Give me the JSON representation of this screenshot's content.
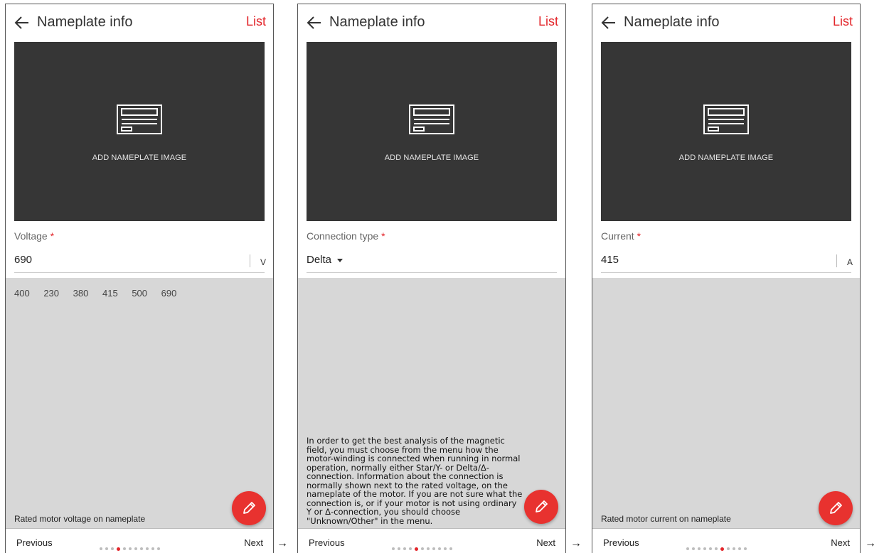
{
  "screens": [
    {
      "title": "Nameplate info",
      "list_label": "List",
      "image_label": "ADD NAMEPLATE IMAGE",
      "field_label": "Voltage",
      "required_mark": "*",
      "field_value": "690",
      "unit": "V",
      "suggestions": [
        "400",
        "230",
        "380",
        "415",
        "500",
        "690"
      ],
      "hint": "Rated motor voltage on nameplate",
      "prev_label": "Previous",
      "next_label": "Next",
      "page_index": 3,
      "page_count": 11
    },
    {
      "title": "Nameplate info",
      "list_label": "List",
      "image_label": "ADD NAMEPLATE IMAGE",
      "field_label": "Connection type",
      "required_mark": "*",
      "field_value": "Delta",
      "help_text": "In order to get the best analysis of the magnetic field, you must choose from the menu how the motor-winding is connected when running in normal operation, normally either Star/Y- or Delta/Δ-connection. Information about the connection is normally shown next to the rated voltage, on the nameplate of the motor.  If you are not sure what the connection is, or if your motor is not using ordinary Y or Δ-connection, you should choose \"Unknown/Other\" in the menu.",
      "prev_label": "Previous",
      "next_label": "Next",
      "page_index": 4,
      "page_count": 11
    },
    {
      "title": "Nameplate info",
      "list_label": "List",
      "image_label": "ADD NAMEPLATE IMAGE",
      "field_label": "Current",
      "required_mark": "*",
      "field_value": "415",
      "unit": "A",
      "hint": "Rated motor current on nameplate",
      "prev_label": "Previous",
      "next_label": "Next",
      "page_index": 6,
      "page_count": 11
    }
  ],
  "flow_arrow": "→",
  "colors": {
    "accent": "#e3262b",
    "image_bg": "#363636",
    "panel_bg": "#d7d7d7"
  }
}
